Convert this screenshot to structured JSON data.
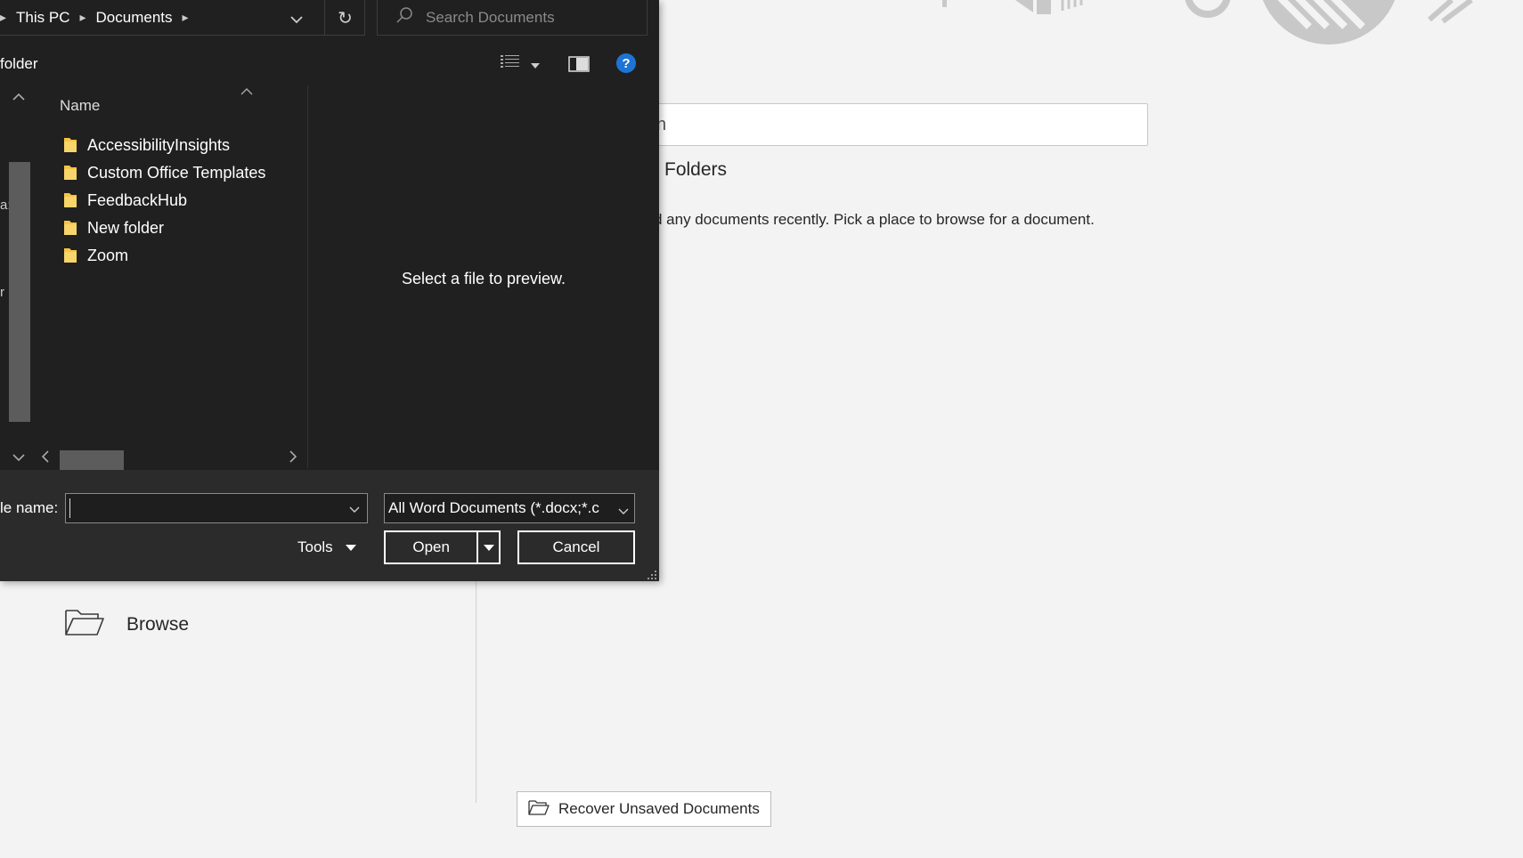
{
  "background": {
    "search_value": "n",
    "folders_heading": "Folders",
    "empty_message": "d any documents recently. Pick a place to browse for a document.",
    "browse_label": "Browse",
    "recover_label": "Recover Unsaved Documents"
  },
  "dialog": {
    "breadcrumb": [
      "This PC",
      "Documents"
    ],
    "search_placeholder": "Search Documents",
    "new_folder_label": "folder",
    "nav_fragments": [
      "a:",
      "r"
    ],
    "column_header": "Name",
    "files": [
      {
        "name": "AccessibilityInsights",
        "icon": "folder-icon"
      },
      {
        "name": "Custom Office Templates",
        "icon": "folder-icon"
      },
      {
        "name": "FeedbackHub",
        "icon": "folder-icon"
      },
      {
        "name": "New folder",
        "icon": "folder-icon"
      },
      {
        "name": "Zoom",
        "icon": "folder-icon"
      }
    ],
    "preview_message": "Select a file to preview.",
    "file_name_label": "le name:",
    "file_name_value": "",
    "file_type_value": "All Word Documents (*.docx;*.c",
    "tools_label": "Tools",
    "open_label": "Open",
    "cancel_label": "Cancel"
  },
  "colors": {
    "dialog_bg": "#202020",
    "bottom_bg": "#2b2b2b",
    "page_bg": "#f3f3f3",
    "folder_yellow": "#f5c542",
    "help_blue": "#1e74d6"
  }
}
